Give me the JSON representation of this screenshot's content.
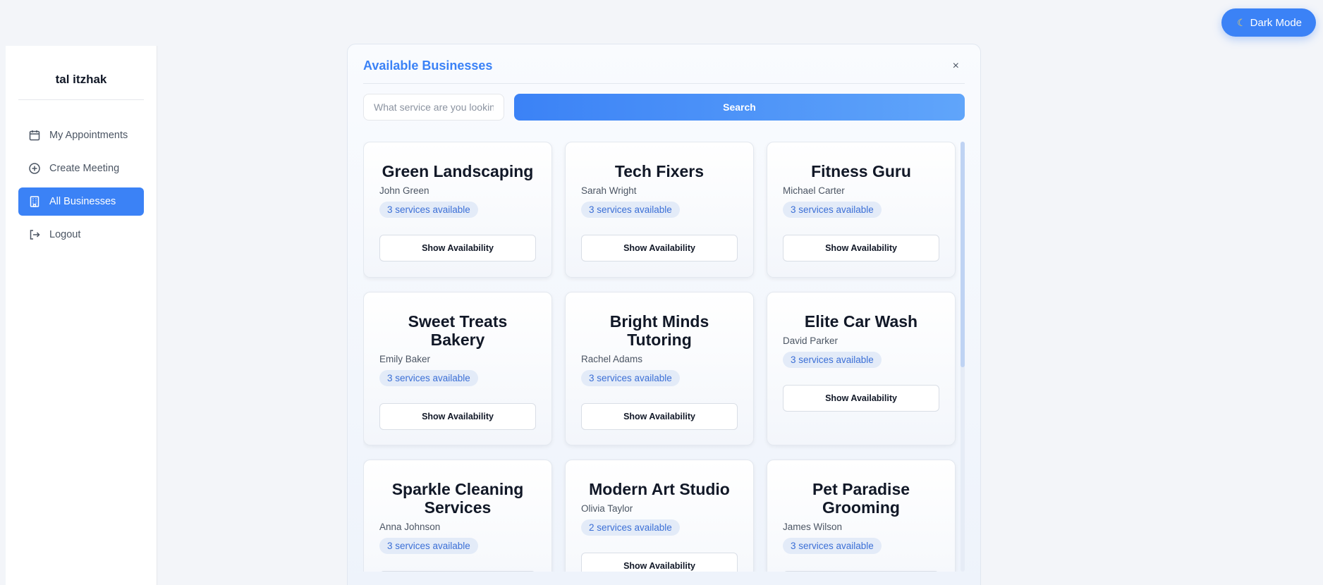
{
  "toolbar": {
    "dark_mode_label": "Dark Mode",
    "dark_mode_icon": "moon-icon"
  },
  "sidebar": {
    "user_name": "tal itzhak",
    "items": [
      {
        "label": "My Appointments",
        "icon": "calendar-icon",
        "active": false
      },
      {
        "label": "Create Meeting",
        "icon": "plus-circle-icon",
        "active": false
      },
      {
        "label": "All Businesses",
        "icon": "building-icon",
        "active": true
      },
      {
        "label": "Logout",
        "icon": "logout-icon",
        "active": false
      }
    ]
  },
  "modal": {
    "title": "Available Businesses",
    "close_label": "×",
    "search_placeholder": "What service are you looking for?",
    "search_button": "Search",
    "show_availability_label": "Show Availability",
    "businesses": [
      {
        "name": "Green Landscaping",
        "owner": "John Green",
        "services": "3 services available"
      },
      {
        "name": "Tech Fixers",
        "owner": "Sarah Wright",
        "services": "3 services available"
      },
      {
        "name": "Fitness Guru",
        "owner": "Michael Carter",
        "services": "3 services available"
      },
      {
        "name": "Sweet Treats Bakery",
        "owner": "Emily Baker",
        "services": "3 services available"
      },
      {
        "name": "Bright Minds Tutoring",
        "owner": "Rachel Adams",
        "services": "3 services available"
      },
      {
        "name": "Elite Car Wash",
        "owner": "David Parker",
        "services": "3 services available"
      },
      {
        "name": "Sparkle Cleaning Services",
        "owner": "Anna Johnson",
        "services": "3 services available"
      },
      {
        "name": "Modern Art Studio",
        "owner": "Olivia Taylor",
        "services": "2 services available"
      },
      {
        "name": "Pet Paradise Grooming",
        "owner": "James Wilson",
        "services": "3 services available"
      }
    ]
  },
  "colors": {
    "accent": "#3b82f6",
    "badge_bg": "#e3ebf8",
    "page_bg": "#f3f5f9"
  }
}
